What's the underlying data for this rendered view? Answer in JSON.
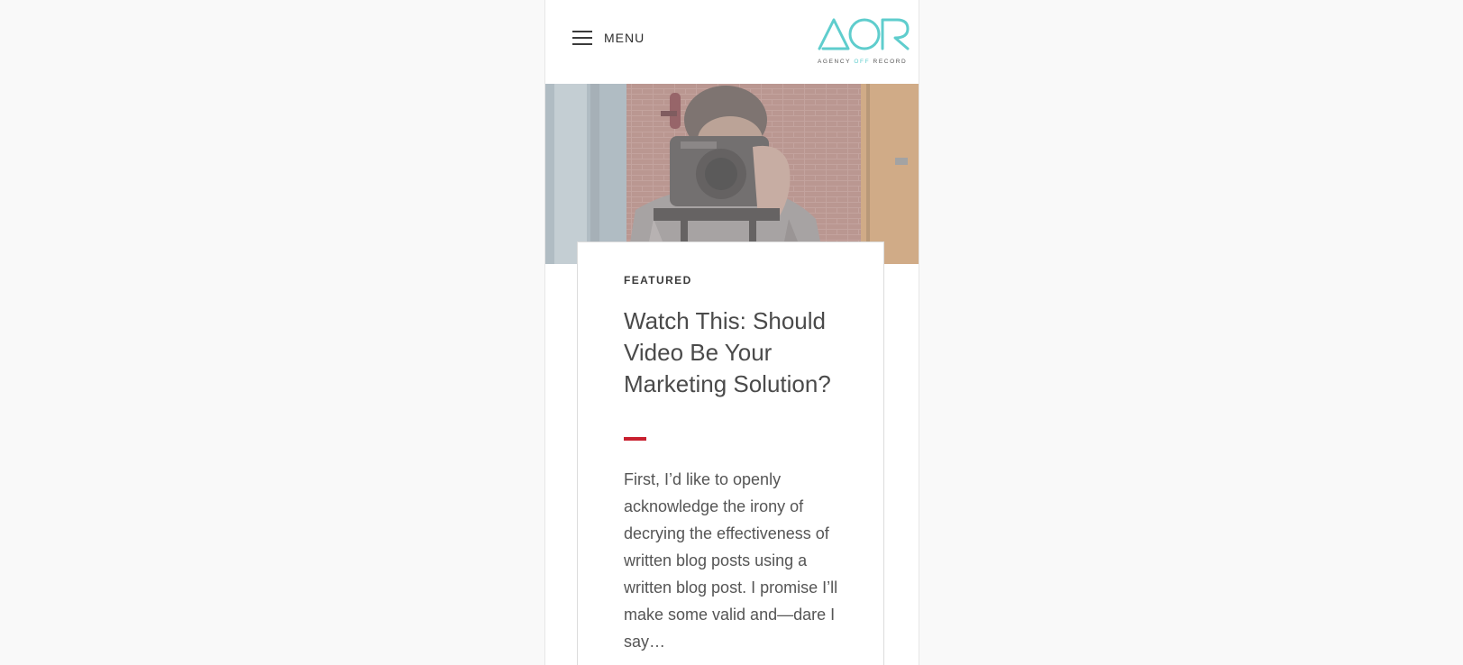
{
  "header": {
    "menu_label": "MENU",
    "logo": {
      "wordmark": "AOR",
      "tagline_before": "AGENCY ",
      "tagline_highlight": "OFF",
      "tagline_after": " RECORD",
      "brand_color": "#5fcdcd"
    }
  },
  "hero": {
    "image_subject": "man-with-camera-image"
  },
  "article": {
    "category": "FEATURED",
    "title": "Watch This: Should Video Be Your Marketing Solution?",
    "excerpt": "First, I’d like to openly acknowledge the irony of decrying the effectiveness of written blog posts using a written blog post. I promise I’ll make some valid and—dare I say…",
    "accent_color": "#c8202f"
  },
  "colors": {
    "page_background": "#f9f9f9",
    "card_border": "#dcdcdc",
    "text_dark": "#4a4a4a"
  }
}
